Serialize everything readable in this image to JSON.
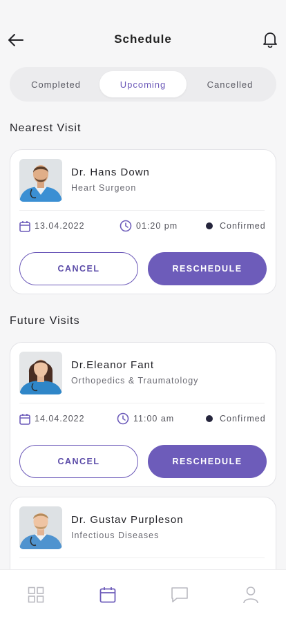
{
  "header": {
    "title": "Schedule"
  },
  "tabs": [
    {
      "label": "Completed",
      "active": false
    },
    {
      "label": "Upcoming",
      "active": true
    },
    {
      "label": "Cancelled",
      "active": false
    }
  ],
  "sections": {
    "nearest": "Nearest Visit",
    "future": "Future Visits"
  },
  "visits": [
    {
      "doctor": "Dr. Hans Down",
      "specialty": "Heart Surgeon",
      "date": "13.04.2022",
      "time": "01:20 pm",
      "status": "Confirmed",
      "cancel_label": "CANCEL",
      "reschedule_label": "RESCHEDULE"
    },
    {
      "doctor": "Dr.Eleanor Fant",
      "specialty": "Orthopedics & Traumatology",
      "date": "14.04.2022",
      "time": "11:00 am",
      "status": "Confirmed",
      "cancel_label": "CANCEL",
      "reschedule_label": "RESCHEDULE"
    },
    {
      "doctor": "Dr. Gustav Purpleson",
      "specialty": "Infectious Diseases"
    }
  ],
  "nav": {
    "items": [
      "home-grid-icon",
      "calendar-icon",
      "chat-icon",
      "profile-icon"
    ],
    "active": "calendar-icon"
  },
  "colors": {
    "accent": "#6d5cba",
    "background": "#f6f6f7",
    "card": "#ffffff",
    "status_dot": "#25253c"
  }
}
